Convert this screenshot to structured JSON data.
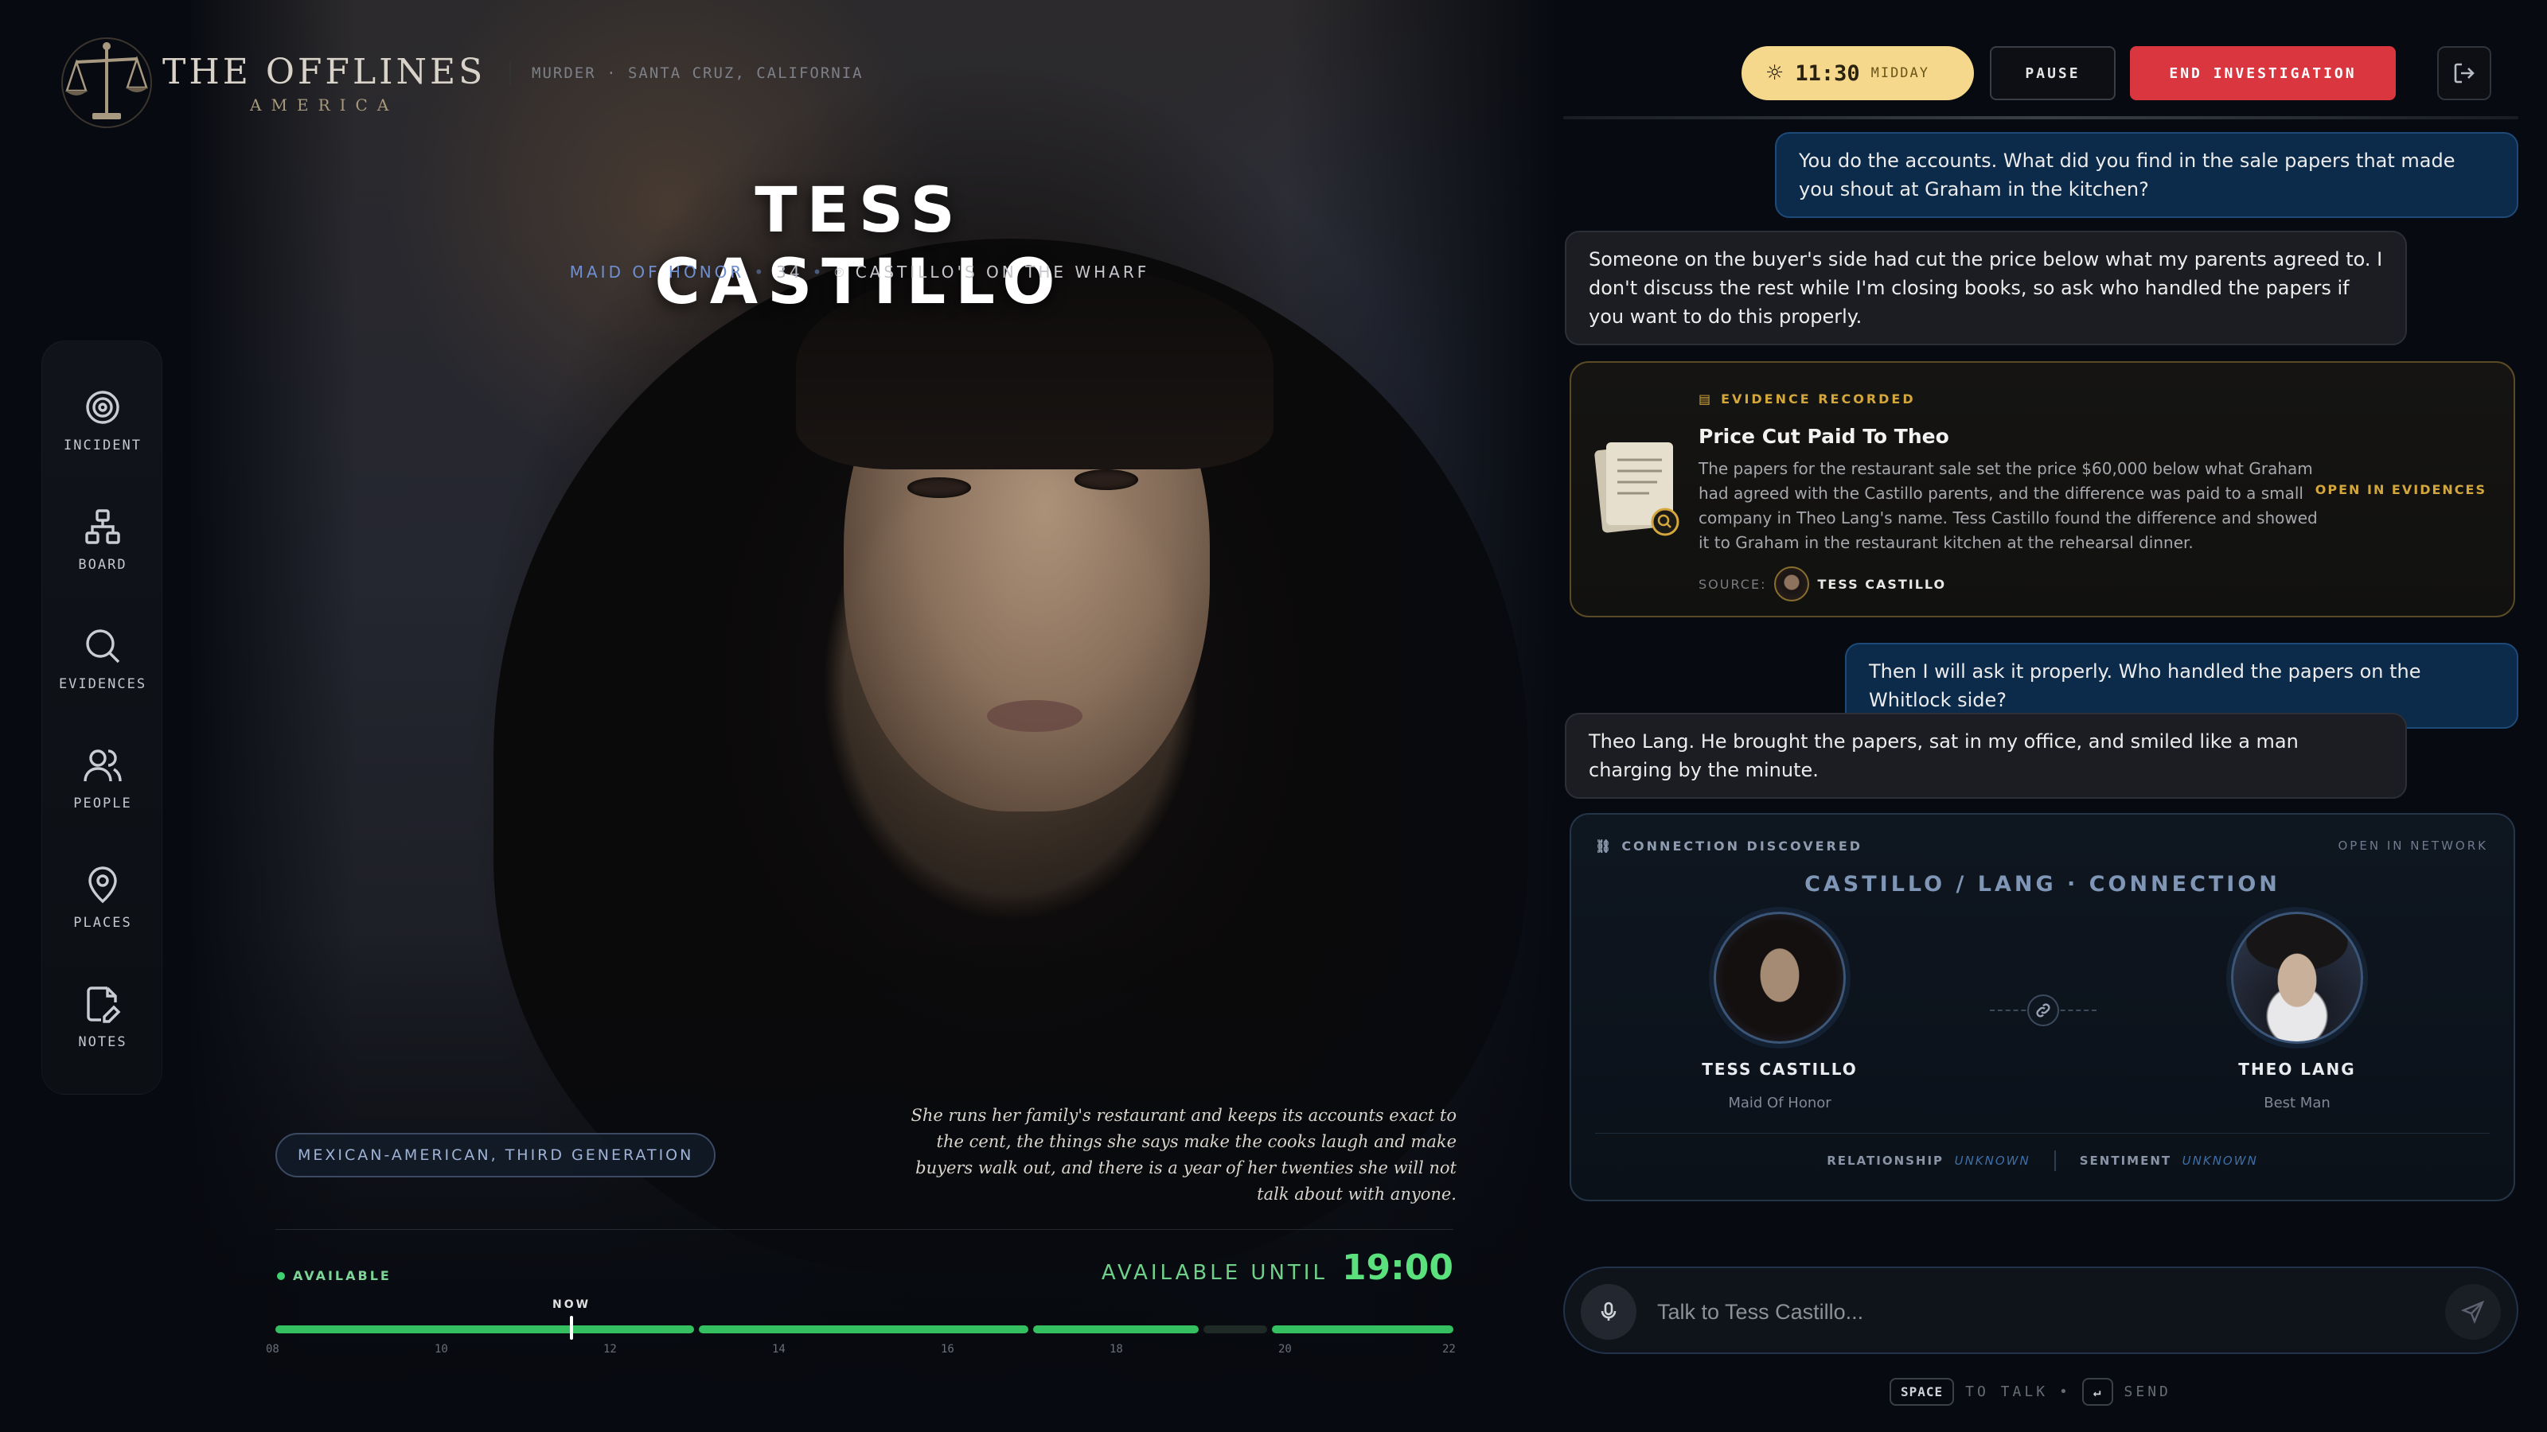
{
  "app": {
    "title": "THE OFFLINES",
    "subtitle": "AMERICA",
    "breadcrumb": "MURDER · SANTA CRUZ, CALIFORNIA"
  },
  "sidebar": {
    "items": [
      {
        "label": "INCIDENT",
        "icon": "target-icon"
      },
      {
        "label": "BOARD",
        "icon": "org-chart-icon"
      },
      {
        "label": "EVIDENCES",
        "icon": "search-icon"
      },
      {
        "label": "PEOPLE",
        "icon": "people-icon"
      },
      {
        "label": "PLACES",
        "icon": "map-pin-icon"
      },
      {
        "label": "NOTES",
        "icon": "note-pen-icon"
      }
    ]
  },
  "character": {
    "name": "TESS CASTILLO",
    "role": "MAID OF HONOR",
    "age": "34",
    "location": "CASTILLO'S ON THE WHARF",
    "heritage": "MEXICAN-AMERICAN, THIRD GENERATION",
    "bio": "She runs her family's restaurant and keeps its accounts exact to the cent, the things she says make the cooks laugh and make buyers walk out, and there is a year of her twenties she will not talk about with anyone."
  },
  "availability": {
    "status": "AVAILABLE",
    "until_label": "AVAILABLE UNTIL",
    "until_time": "19:00",
    "now_label": "NOW",
    "ticks": [
      "08",
      "10",
      "12",
      "14",
      "16",
      "18",
      "20",
      "22"
    ],
    "accent": "#34c060"
  },
  "controls": {
    "time": "11:30",
    "period": "MIDDAY",
    "pause_label": "PAUSE",
    "end_label": "END INVESTIGATION",
    "end_color": "#d9363f"
  },
  "chat": {
    "messages": [
      {
        "from": "user",
        "text": "You do the accounts. What did you find in the sale papers that made you shout at Graham in the kitchen?"
      },
      {
        "from": "npc",
        "text": "Someone on the buyer's side had cut the price below what my parents agreed to. I don't discuss the rest while I'm closing books, so ask who handled the papers if you want to do this properly."
      },
      {
        "from": "user",
        "text": "Then I will ask it properly. Who handled the papers on the Whitlock side?"
      },
      {
        "from": "npc",
        "text": "Theo Lang. He brought the papers, sat in my office, and smiled like a man charging by the minute."
      }
    ],
    "evidence": {
      "header": "EVIDENCE RECORDED",
      "title": "Price Cut Paid To Theo",
      "description": "The papers for the restaurant sale set the price $60,000 below what Graham had agreed with the Castillo parents, and the difference was paid to a small company in Theo Lang's name. Tess Castillo found the difference and showed it to Graham in the restaurant kitchen at the rehearsal dinner.",
      "source_label": "SOURCE:",
      "source_name": "TESS CASTILLO",
      "open_label": "OPEN IN EVIDENCES"
    },
    "connection": {
      "header": "CONNECTION DISCOVERED",
      "open_label": "OPEN IN NETWORK",
      "title": "CASTILLO / LANG · CONNECTION",
      "left": {
        "name": "TESS CASTILLO",
        "role": "Maid Of Honor"
      },
      "right": {
        "name": "THEO LANG",
        "role": "Best Man"
      },
      "relationship_label": "RELATIONSHIP",
      "relationship_value": "UNKNOWN",
      "sentiment_label": "SENTIMENT",
      "sentiment_value": "UNKNOWN"
    },
    "input": {
      "placeholder": "Talk to Tess Castillo...",
      "hint_key_talk": "SPACE",
      "hint_talk": "TO TALK",
      "hint_key_send": "↵",
      "hint_send": "SEND"
    }
  }
}
